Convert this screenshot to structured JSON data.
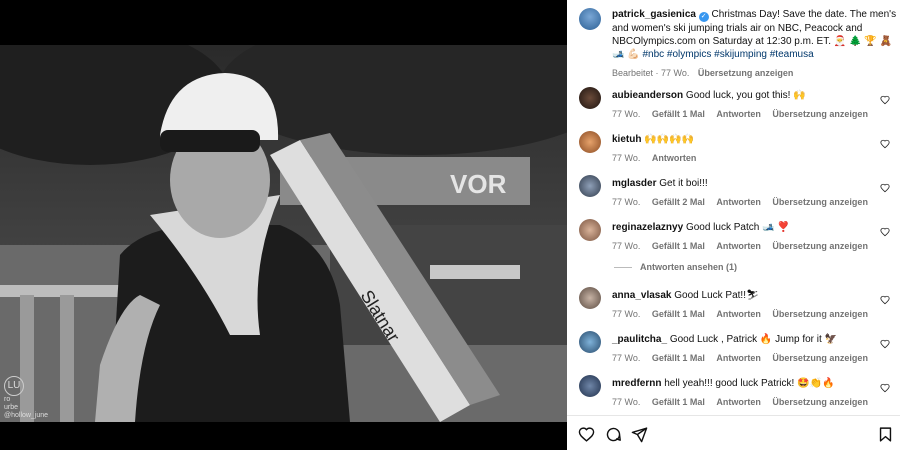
{
  "post": {
    "username": "patrick_gasienica",
    "caption": "Christmas Day! Save the date. The men's and women's ski jumping trials air on NBC, Peacock and NBCOlympics.com on Saturday at 12:30 p.m. ET. 🎅 🌲 🏆 🧸",
    "hashtags": "🎿 💪🏻 #nbc #olympics #skijumping #teamusa",
    "edited": "Bearbeitet · 77 Wo.",
    "translate": "Übersetzung anzeigen"
  },
  "media": {
    "watermark_logo": "LU",
    "watermark_text1": "ro",
    "watermark_text2": "urbe",
    "watermark_handle": "@hollow_june",
    "banner_text": "VOR"
  },
  "comments": [
    {
      "username": "aubieanderson",
      "text": "Good luck, you got this! 🙌",
      "time": "77 Wo.",
      "likes": "Gefällt 1 Mal",
      "reply": "Antworten",
      "translate": "Übersetzung anzeigen"
    },
    {
      "username": "kietuh",
      "text": "🙌🙌🙌🙌",
      "time": "77 Wo.",
      "likes": "",
      "reply": "Antworten",
      "translate": ""
    },
    {
      "username": "mglasder",
      "text": "Get it boi!!!",
      "time": "77 Wo.",
      "likes": "Gefällt 2 Mal",
      "reply": "Antworten",
      "translate": "Übersetzung anzeigen"
    },
    {
      "username": "reginazelaznyy",
      "text": "Good luck Patch 🎿 ❣️",
      "time": "77 Wo.",
      "likes": "Gefällt 1 Mal",
      "reply": "Antworten",
      "translate": "Übersetzung anzeigen"
    },
    {
      "username": "anna_vlasak",
      "text": "Good Luck Pat!!⛷",
      "time": "77 Wo.",
      "likes": "Gefällt 1 Mal",
      "reply": "Antworten",
      "translate": "Übersetzung anzeigen"
    },
    {
      "username": "_paulitcha_",
      "text": "Good Luck , Patrick 🔥 Jump for it 🦅",
      "time": "77 Wo.",
      "likes": "Gefällt 1 Mal",
      "reply": "Antworten",
      "translate": "Übersetzung anzeigen"
    },
    {
      "username": "mredfernn",
      "text": "hell yeah!!! good luck Patrick! 🤩👏🔥",
      "time": "77 Wo.",
      "likes": "Gefällt 1 Mal",
      "reply": "Antworten",
      "translate": "Übersetzung anzeigen"
    }
  ],
  "view_replies": "Antworten ansehen (1)",
  "icons": {
    "like": "heart-icon",
    "comment": "comment-icon",
    "share": "share-icon",
    "save": "bookmark-icon",
    "verified": "verified-badge-icon"
  },
  "colors": {
    "link": "#00376b",
    "verified": "#3897f0",
    "muted": "#737373"
  }
}
